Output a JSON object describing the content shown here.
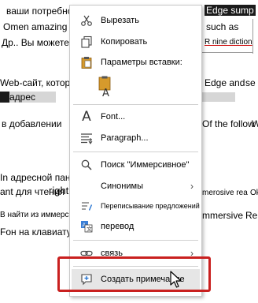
{
  "document": {
    "line1a": "ваши потребности. Я",
    "line1b": "Edge sump",
    "line2a": "Omen amazing I",
    "line2b": "such as",
    "line3a": "Др.. Вы можете",
    "line3b": "R nine diction",
    "line4a": "Web-сайт, который у",
    "line4b": "Edge and",
    "line4c": "se",
    "line5a": "адрес",
    "line6a": "в добавлении",
    "line6b": "Of the follow",
    "line6c": "W",
    "line7a": "In адресной панели",
    "line8a": "ant для чтения",
    "line8b": "right",
    "line8c": "merosive rea",
    "line8d": "Ok",
    "line9a": "В найти из иммерсивного",
    "line9b": "mmersive",
    "line9c": "Re",
    "line10a": "Fон на клавиатуре"
  },
  "menu": {
    "cut": "Вырезать",
    "copy": "Копировать",
    "paste_options": "Параметры вставки:",
    "font": "Font...",
    "paragraph": "Paragraph...",
    "immersive_search": "Поиск \"Иммерсивное\"",
    "synonyms": "Синонимы",
    "rewrite": "Переписывание предложений",
    "translate": "перевод",
    "link": "связь",
    "new_comment": "Создать примечание"
  },
  "colors": {
    "highlight_box": "#c9201f",
    "hover_bg": "#e6e6e6"
  }
}
